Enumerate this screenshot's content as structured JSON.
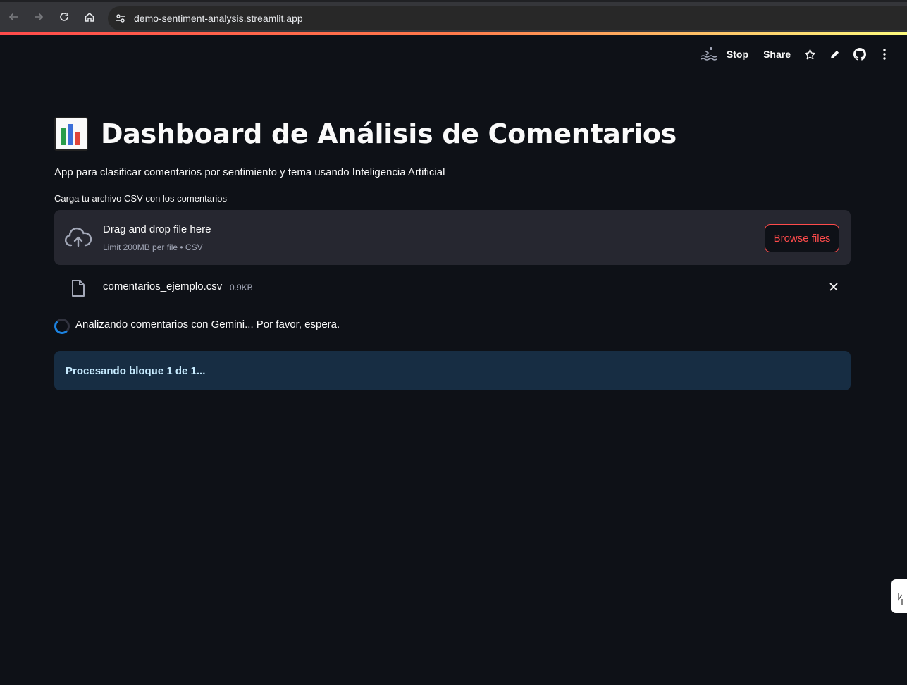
{
  "browser": {
    "url": "demo-sentiment-analysis.streamlit.app"
  },
  "toolbar": {
    "stop_label": "Stop",
    "share_label": "Share"
  },
  "page": {
    "title": "Dashboard de Análisis de Comentarios",
    "subtitle": "App para clasificar comentarios por sentimiento y tema usando Inteligencia Artificial"
  },
  "uploader": {
    "label": "Carga tu archivo CSV con los comentarios",
    "drop_title": "Drag and drop file here",
    "limit_text": "Limit 200MB per file • CSV",
    "browse_label": "Browse files",
    "file": {
      "name": "comentarios_ejemplo.csv",
      "size": "0.9KB"
    }
  },
  "status": {
    "spinner_text": "Analizando comentarios con Gemini... Por favor, espera.",
    "info_text": "Procesando bloque 1 de 1..."
  },
  "colors": {
    "background": "#0e1117",
    "accent": "#ff4b4b",
    "info_bg": "#172d43",
    "info_text": "#c7ebff"
  }
}
